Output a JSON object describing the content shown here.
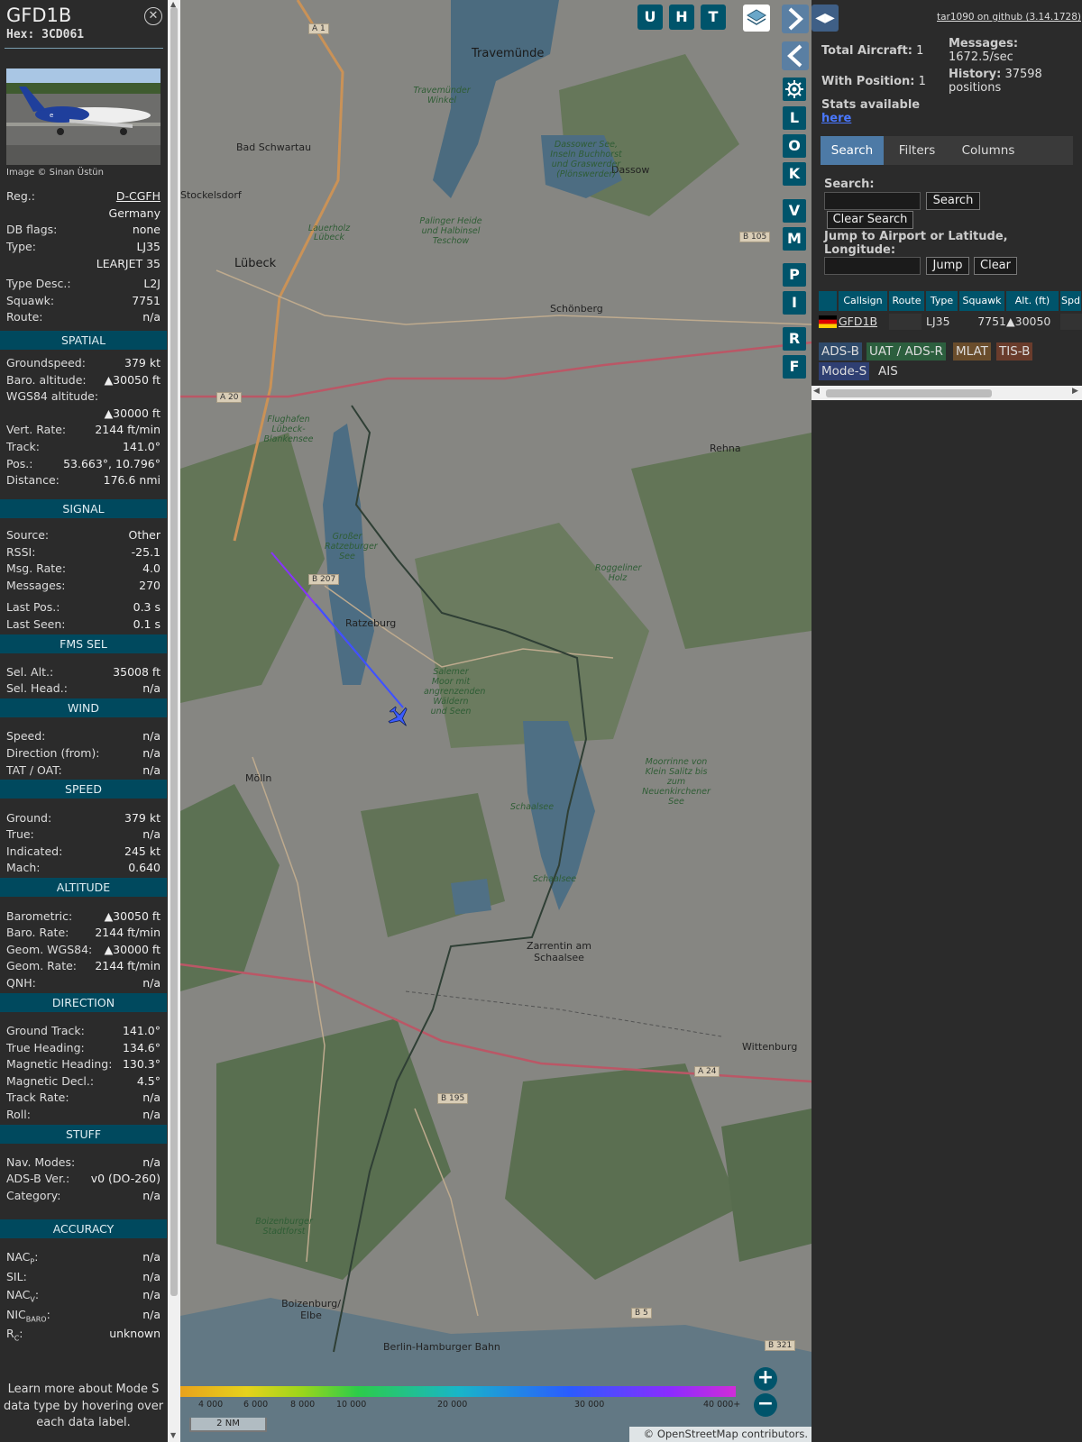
{
  "aircraft": {
    "callsign": "GFD1B",
    "hex": "Hex: 3CD061",
    "image_credit": "Image © Sinan Üstün",
    "basic": [
      {
        "label": "Reg.:",
        "value": "D-CGFH"
      },
      {
        "label": "",
        "value": "Germany"
      },
      {
        "label": "DB flags:",
        "value": "none"
      },
      {
        "label": "Type:",
        "value": "LJ35"
      },
      {
        "label": "",
        "value": "LEARJET 35"
      },
      {
        "label": "Type Desc.:",
        "value": "L2J"
      },
      {
        "label": "Squawk:",
        "value": "7751"
      },
      {
        "label": "Route:",
        "value": "n/a"
      }
    ],
    "spatial_title": "SPATIAL",
    "spatial": [
      {
        "label": "Groundspeed:",
        "value": "379 kt"
      },
      {
        "label": "Baro. altitude:",
        "value": "▲30050 ft"
      },
      {
        "label": "WGS84 altitude:",
        "value": ""
      },
      {
        "label": "",
        "value": "▲30000 ft"
      },
      {
        "label": "Vert. Rate:",
        "value": "2144 ft/min"
      },
      {
        "label": "Track:",
        "value": "141.0°"
      },
      {
        "label": "Pos.:",
        "value": "53.663°, 10.796°"
      },
      {
        "label": "Distance:",
        "value": "176.6 nmi"
      }
    ],
    "signal_title": "SIGNAL",
    "signal": [
      {
        "label": "Source:",
        "value": "Other"
      },
      {
        "label": "RSSI:",
        "value": "-25.1"
      },
      {
        "label": "Msg. Rate:",
        "value": "4.0"
      },
      {
        "label": "Messages:",
        "value": "270"
      },
      {
        "label": "Last Pos.:",
        "value": "0.3 s"
      },
      {
        "label": "Last Seen:",
        "value": "0.1 s"
      }
    ],
    "fms_title": "FMS SEL",
    "fms": [
      {
        "label": "Sel. Alt.:",
        "value": "35008 ft"
      },
      {
        "label": "Sel. Head.:",
        "value": "n/a"
      }
    ],
    "wind_title": "WIND",
    "wind": [
      {
        "label": "Speed:",
        "value": "n/a"
      },
      {
        "label": "Direction (from):",
        "value": "n/a"
      },
      {
        "label": "TAT / OAT:",
        "value": "n/a"
      }
    ],
    "speed_title": "SPEED",
    "speed": [
      {
        "label": "Ground:",
        "value": "379 kt"
      },
      {
        "label": "True:",
        "value": "n/a"
      },
      {
        "label": "Indicated:",
        "value": "245 kt"
      },
      {
        "label": "Mach:",
        "value": "0.640"
      }
    ],
    "altitude_title": "ALTITUDE",
    "altitude": [
      {
        "label": "Barometric:",
        "value": "▲30050 ft"
      },
      {
        "label": "Baro. Rate:",
        "value": "2144 ft/min"
      },
      {
        "label": "Geom. WGS84:",
        "value": "▲30000 ft"
      },
      {
        "label": "Geom. Rate:",
        "value": "2144 ft/min"
      },
      {
        "label": "QNH:",
        "value": "n/a"
      }
    ],
    "direction_title": "DIRECTION",
    "direction": [
      {
        "label": "Ground Track:",
        "value": "141.0°"
      },
      {
        "label": "True Heading:",
        "value": "134.6°"
      },
      {
        "label": "Magnetic Heading:",
        "value": "130.3°"
      },
      {
        "label": "Magnetic Decl.:",
        "value": "4.5°"
      },
      {
        "label": "Track Rate:",
        "value": "n/a"
      },
      {
        "label": "Roll:",
        "value": "n/a"
      }
    ],
    "stuff_title": "STUFF",
    "stuff": [
      {
        "label": "Nav. Modes:",
        "value": "n/a"
      },
      {
        "label": "ADS-B Ver.:",
        "value": "v0 (DO-260)"
      },
      {
        "label": "Category:",
        "value": "n/a"
      }
    ],
    "accuracy_title": "ACCURACY",
    "accuracy": [
      {
        "label": "NAC",
        "sub": "P",
        "value": "n/a"
      },
      {
        "label": "SIL:",
        "sub": "",
        "value": "n/a"
      },
      {
        "label": "NAC",
        "sub": "V",
        "value": "n/a"
      },
      {
        "label": "NIC",
        "sub": "BARO",
        "value": "n/a"
      },
      {
        "label": "R",
        "sub": "C",
        "value": "unknown"
      }
    ],
    "learn_more": "Learn more about Mode S data type by hovering over each data label."
  },
  "map": {
    "top_buttons": [
      "U",
      "H",
      "T"
    ],
    "side_buttons": [
      "L",
      "O",
      "K",
      "V",
      "M",
      "P",
      "I",
      "R",
      "F"
    ],
    "places": [
      {
        "name": "Travemünde",
        "cls": "big"
      },
      {
        "name": "Bad Schwartau",
        "cls": ""
      },
      {
        "name": "Stockelsdorf",
        "cls": ""
      },
      {
        "name": "Lübeck",
        "cls": "big"
      },
      {
        "name": "Dassow",
        "cls": ""
      },
      {
        "name": "Schönberg",
        "cls": ""
      },
      {
        "name": "Rehna",
        "cls": ""
      },
      {
        "name": "Ratzeburg",
        "cls": ""
      },
      {
        "name": "Mölln",
        "cls": ""
      },
      {
        "name": "Zarrentin am Schaalsee",
        "cls": ""
      },
      {
        "name": "Wittenburg",
        "cls": ""
      },
      {
        "name": "Boizenburg/ Elbe",
        "cls": ""
      },
      {
        "name": "Berlin-Hamburger Bahn",
        "cls": ""
      }
    ],
    "nature": [
      "Travemünder Winkel",
      "Dassower See, Inseln Buchhorst und Graswerder (Plönswerder)",
      "Palinger Heide und Halbinsel Teschow",
      "Lauerholz",
      "Flughafen Lübeck-Blankensee",
      "Großer Ratzeburger See",
      "Roggeliner Holz",
      "Salemer Moor mit angrenzenden Wäldern und Seen",
      "Moorrinne von Klein Salitz bis zum Neuenkirchener See",
      "Schaalsee",
      "Schaalsee",
      "Lübeck",
      "Boizenburger Stadtforst"
    ],
    "roads": [
      "A 1",
      "B 105",
      "A 20",
      "B 207",
      "A 24",
      "B 195",
      "B 5",
      "B 321"
    ],
    "colorbar_labels": [
      "4 000",
      "6 000",
      "8 000",
      "10 000",
      "20 000",
      "30 000",
      "40 000+"
    ],
    "scale": "2 NM",
    "attribution": "© OpenStreetMap contributors."
  },
  "stats": {
    "version": "tar1090 on github (3.14.1728)",
    "total_label": "Total Aircraft:",
    "total": "1",
    "position_label": "With Position:",
    "position": "1",
    "messages_label": "Messages:",
    "messages": "1672.5/sec",
    "history_label": "History:",
    "history": "37598",
    "history_unit": "positions",
    "stats_available": "Stats available",
    "here": "here"
  },
  "tabs": [
    "Search",
    "Filters",
    "Columns"
  ],
  "search": {
    "label": "Search:",
    "button": "Search",
    "clear": "Clear Search",
    "jump_label": "Jump to Airport or Latitude, Longitude:",
    "jump_button": "Jump",
    "clear2": "Clear"
  },
  "table": {
    "headers": [
      "",
      "Callsign",
      "Route",
      "Type",
      "Squawk",
      "Alt. (ft)",
      "Spd"
    ],
    "rows": [
      {
        "callsign": "GFD1B",
        "route": "",
        "type": "LJ35",
        "squawk": "7751",
        "alt": "▲30050"
      }
    ]
  },
  "sources": [
    {
      "name": "ADS-B",
      "color": "#2f4a6a"
    },
    {
      "name": "UAT / ADS-R",
      "color": "#2c5f3e"
    },
    {
      "name": "MLAT",
      "color": "#6a4d2c"
    },
    {
      "name": "TIS-B",
      "color": "#6a3c2c"
    },
    {
      "name": "Mode-S",
      "color": "#2f3f72"
    },
    {
      "name": "AIS",
      "color": ""
    }
  ],
  "colors": {
    "accent": "#00546b",
    "section": "#00495e",
    "tab_active": "#4d7aa6",
    "track_line": "#5555ff"
  }
}
